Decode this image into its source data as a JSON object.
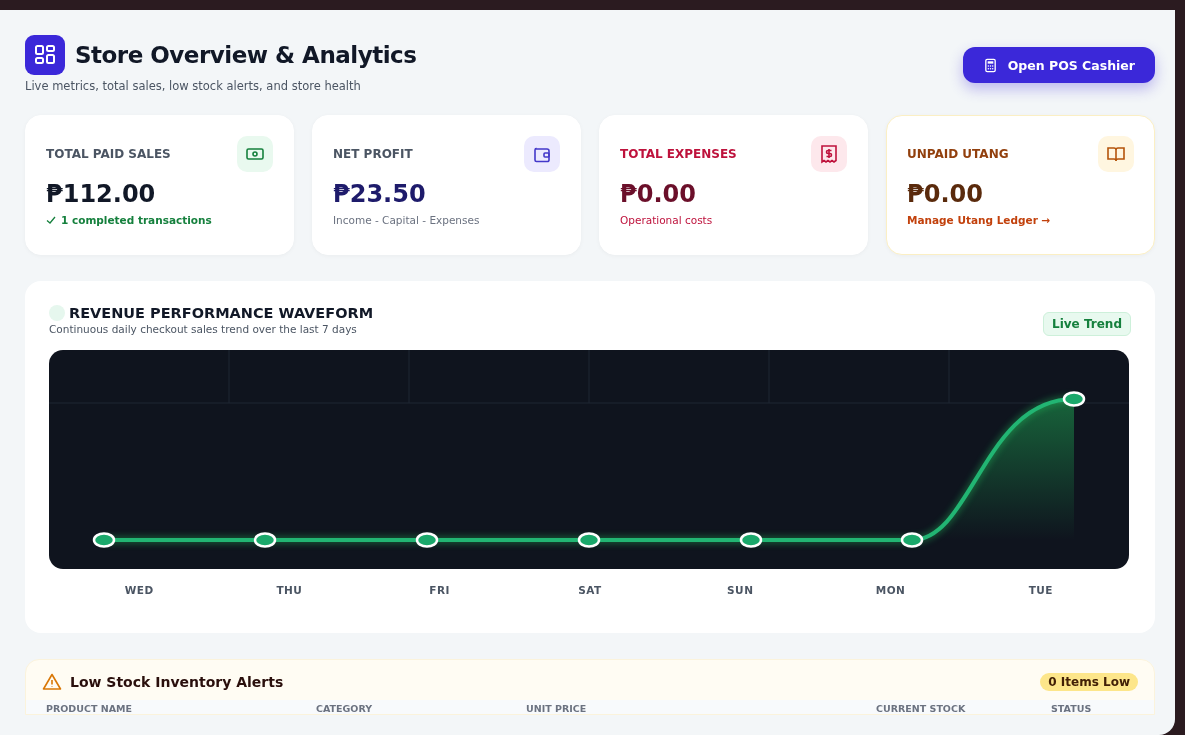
{
  "header": {
    "title": "Store Overview & Analytics",
    "subtitle": "Live metrics, total sales, low stock alerts, and store health",
    "button": "Open POS Cashier"
  },
  "cards": [
    {
      "kind": "sales",
      "label": "TOTAL PAID SALES",
      "value": "₱112.00",
      "note": {
        "kind": "check",
        "text": "1 completed transactions"
      }
    },
    {
      "kind": "profit",
      "label": "NET PROFIT",
      "value": "₱23.50",
      "note": {
        "kind": "plain",
        "text": "Income - Capital - Expenses"
      }
    },
    {
      "kind": "expenses",
      "label": "TOTAL EXPENSES",
      "value": "₱0.00",
      "note": {
        "kind": "plain",
        "text": "Operational costs"
      }
    },
    {
      "kind": "utang",
      "label": "UNPAID UTANG",
      "value": "₱0.00",
      "note": {
        "kind": "link",
        "text": "Manage Utang Ledger →"
      }
    }
  ],
  "revenue": {
    "title": "REVENUE PERFORMANCE WAVEFORM",
    "subtitle": "Continuous daily checkout sales trend over the last 7 days",
    "badge": "Live Trend",
    "days": [
      "WED",
      "THU",
      "FRI",
      "SAT",
      "SUN",
      "MON",
      "TUE"
    ]
  },
  "alerts": {
    "title": "Low Stock Inventory Alerts",
    "badge": "0 Items Low",
    "columns": [
      "PRODUCT NAME",
      "CATEGORY",
      "UNIT PRICE",
      "CURRENT STOCK",
      "STATUS"
    ]
  }
}
